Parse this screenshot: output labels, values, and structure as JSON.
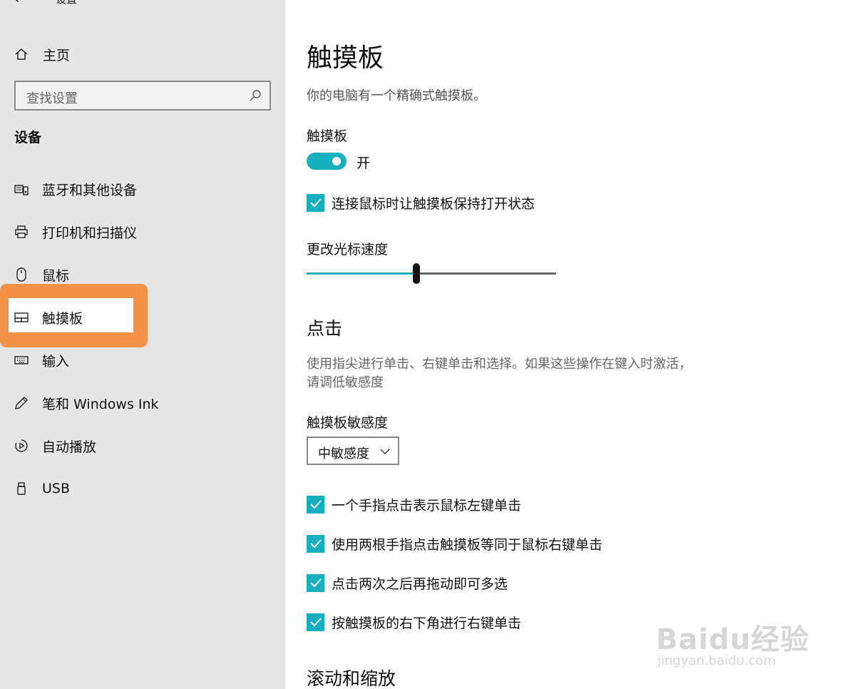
{
  "window": {
    "title": "设置"
  },
  "sidebar": {
    "home_label": "主页",
    "search_placeholder": "查找设置",
    "section_title": "设备",
    "items": [
      {
        "label": "蓝牙和其他设备",
        "icon": "keyboard-device-icon"
      },
      {
        "label": "打印机和扫描仪",
        "icon": "printer-icon"
      },
      {
        "label": "鼠标",
        "icon": "mouse-icon"
      },
      {
        "label": "触摸板",
        "icon": "touchpad-icon",
        "selected": true
      },
      {
        "label": "输入",
        "icon": "keyboard-icon"
      },
      {
        "label": "笔和 Windows Ink",
        "icon": "pen-icon"
      },
      {
        "label": "自动播放",
        "icon": "autoplay-icon"
      },
      {
        "label": "USB",
        "icon": "usb-icon"
      }
    ]
  },
  "main": {
    "title": "触摸板",
    "description": "你的电脑有一个精确式触摸板。",
    "touchpad_label": "触摸板",
    "toggle_state": "开",
    "keep_on_with_mouse": "连接鼠标时让触摸板保持打开状态",
    "cursor_speed_label": "更改光标速度",
    "cursor_speed_fraction": 0.44,
    "taps_heading": "点击",
    "taps_description": "使用指尖进行单击、右键单击和选择。如果这些操作在键入时激活，请调低敏感度",
    "sensitivity_label": "触摸板敏感度",
    "sensitivity_value": "中敏感度",
    "checkboxes": [
      "一个手指点击表示鼠标左键单击",
      "使用两根手指点击触摸板等同于鼠标右键单击",
      "点击两次之后再拖动即可多选",
      "按触摸板的右下角进行右键单击"
    ],
    "scroll_heading": "滚动和缩放"
  },
  "watermark": {
    "text": "Baidu经验",
    "sub": "jingyan.baidu.com"
  },
  "colors": {
    "accent": "#17aebf",
    "highlight": "#f39247",
    "sidebar_bg": "#e6e6e6"
  }
}
